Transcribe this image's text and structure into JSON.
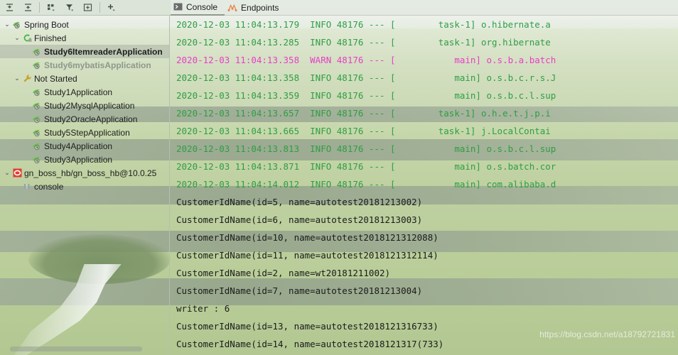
{
  "toolbar": {
    "buttons": [
      {
        "name": "expand-all-icon",
        "label": "Expand All"
      },
      {
        "name": "collapse-all-icon",
        "label": "Collapse All"
      },
      {
        "name": "group-by-icon",
        "label": "Group By"
      },
      {
        "name": "filter-icon",
        "label": "Filter"
      },
      {
        "name": "add-tab-icon",
        "label": "Add Tab"
      },
      {
        "name": "add-icon",
        "label": "Add"
      }
    ]
  },
  "tabs": [
    {
      "label": "Console",
      "icon": "console-icon",
      "active": true
    },
    {
      "label": "Endpoints",
      "icon": "endpoints-icon",
      "active": false
    }
  ],
  "sidebar": {
    "items": [
      {
        "label": "Spring Boot",
        "indent": 0,
        "arrow": "⌄",
        "icon": "spring-boot-icon",
        "state": "normal"
      },
      {
        "label": "Finished",
        "indent": 1,
        "arrow": "⌄",
        "icon": "finished-icon",
        "state": "normal"
      },
      {
        "label": "Study6ItemreaderApplication",
        "indent": 2,
        "arrow": "",
        "icon": "spring-run-icon",
        "state": "selected"
      },
      {
        "label": "Study6mybatisApplication",
        "indent": 2,
        "arrow": "",
        "icon": "spring-run-icon",
        "state": "dim"
      },
      {
        "label": "Not Started",
        "indent": 1,
        "arrow": "⌄",
        "icon": "wrench-icon",
        "state": "normal"
      },
      {
        "label": "Study1Application",
        "indent": 2,
        "arrow": "",
        "icon": "spring-run-icon",
        "state": "normal"
      },
      {
        "label": "Study2MysqlApplication",
        "indent": 2,
        "arrow": "",
        "icon": "spring-run-icon",
        "state": "normal"
      },
      {
        "label": "Study2OracleApplication",
        "indent": 2,
        "arrow": "",
        "icon": "spring-run-icon",
        "state": "normal"
      },
      {
        "label": "Study5StepApplication",
        "indent": 2,
        "arrow": "",
        "icon": "spring-run-icon",
        "state": "normal"
      },
      {
        "label": "Study4Application",
        "indent": 2,
        "arrow": "",
        "icon": "spring-run-icon",
        "state": "normal"
      },
      {
        "label": "Study3Application",
        "indent": 2,
        "arrow": "",
        "icon": "spring-run-icon",
        "state": "normal"
      },
      {
        "label": "gn_boss_hb/gn_boss_hb@10.0.25",
        "indent": 0,
        "arrow": "⌄",
        "icon": "stop-icon",
        "state": "normal"
      },
      {
        "label": "console",
        "indent": 1,
        "arrow": "",
        "icon": "console-small-icon",
        "state": "normal"
      }
    ]
  },
  "console": {
    "lines": [
      {
        "level": "info",
        "text": "2020-12-03 11:04:13.179  INFO 48176 --- [        task-1] o.hibernate.a"
      },
      {
        "level": "info",
        "text": "2020-12-03 11:04:13.285  INFO 48176 --- [        task-1] org.hibernate"
      },
      {
        "level": "warn",
        "text": "2020-12-03 11:04:13.358  WARN 48176 --- [           main] o.s.b.a.batch"
      },
      {
        "level": "info",
        "text": "2020-12-03 11:04:13.358  INFO 48176 --- [           main] o.s.b.c.r.s.J"
      },
      {
        "level": "info",
        "text": "2020-12-03 11:04:13.359  INFO 48176 --- [           main] o.s.b.c.l.sup"
      },
      {
        "level": "info",
        "text": "2020-12-03 11:04:13.657  INFO 48176 --- [        task-1] o.h.e.t.j.p.i"
      },
      {
        "level": "info",
        "text": "2020-12-03 11:04:13.665  INFO 48176 --- [        task-1] j.LocalContai"
      },
      {
        "level": "info",
        "text": "2020-12-03 11:04:13.813  INFO 48176 --- [           main] o.s.b.c.l.sup"
      },
      {
        "level": "info",
        "text": "2020-12-03 11:04:13.871  INFO 48176 --- [           main] o.s.batch.cor"
      },
      {
        "level": "info",
        "text": "2020-12-03 11:04:14.012  INFO 48176 --- [           main] com.alibaba.d"
      },
      {
        "level": "out",
        "text": "CustomerIdName(id=5, name=autotest20181213002)"
      },
      {
        "level": "out",
        "text": "CustomerIdName(id=6, name=autotest20181213003)"
      },
      {
        "level": "out",
        "text": "CustomerIdName(id=10, name=autotest2018121312088)"
      },
      {
        "level": "out",
        "text": "CustomerIdName(id=11, name=autotest2018121312114)"
      },
      {
        "level": "out",
        "text": "CustomerIdName(id=2, name=wt20181211002)"
      },
      {
        "level": "out",
        "text": "CustomerIdName(id=7, name=autotest20181213004)"
      },
      {
        "level": "out",
        "text": "writer : 6"
      },
      {
        "level": "out",
        "text": "CustomerIdName(id=13, name=autotest2018121316733)"
      },
      {
        "level": "out",
        "text": "CustomerIdName(id=14, name=autotest2018121317(733)"
      }
    ]
  },
  "watermark": {
    "text": "https://blog.csdn.net/a18792721831"
  },
  "colors": {
    "info": "#2f9e44",
    "warn": "#e83ec7",
    "stdout": "#1b1b1b",
    "selection": "#a0a89e"
  }
}
